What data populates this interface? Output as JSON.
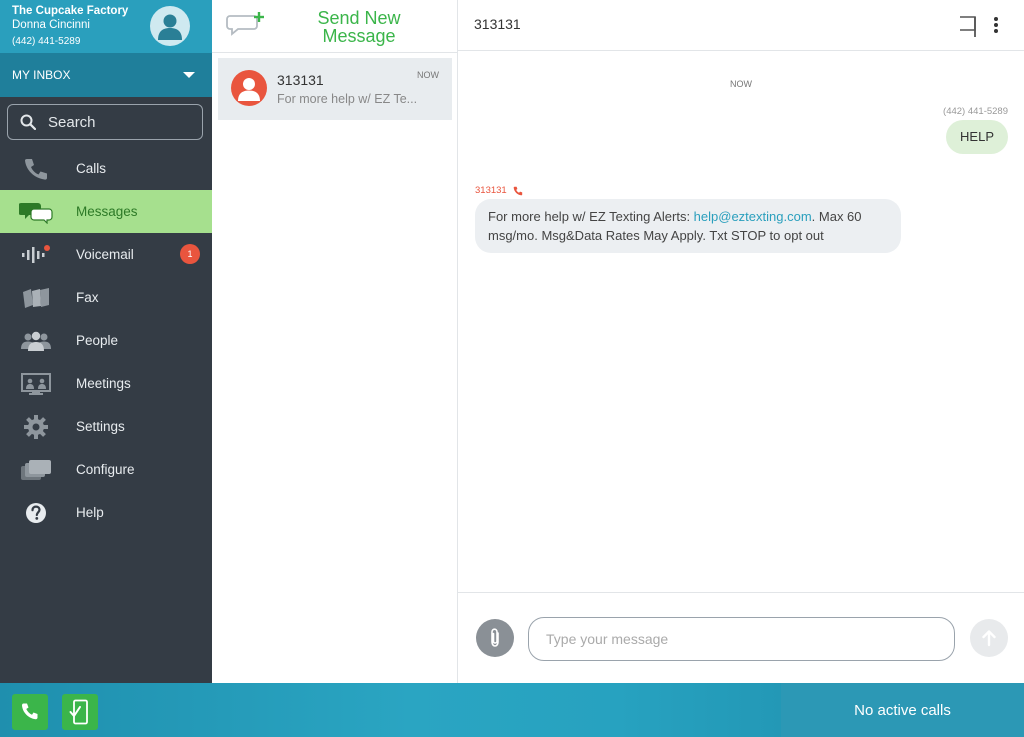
{
  "account": {
    "company": "The Cupcake Factory",
    "user": "Donna Cincinni",
    "phone": "(442) 441-5289"
  },
  "inbox": {
    "label": "MY INBOX"
  },
  "search": {
    "placeholder": "Search"
  },
  "nav": {
    "items": [
      {
        "label": "Calls",
        "icon": "phone-icon"
      },
      {
        "label": "Messages",
        "icon": "chat-bubbles-icon",
        "active": true
      },
      {
        "label": "Voicemail",
        "icon": "voicemail-icon",
        "badge": "1"
      },
      {
        "label": "Fax",
        "icon": "fax-icon"
      },
      {
        "label": "People",
        "icon": "people-icon"
      },
      {
        "label": "Meetings",
        "icon": "meetings-icon"
      },
      {
        "label": "Settings",
        "icon": "gear-icon"
      },
      {
        "label": "Configure",
        "icon": "configure-icon"
      },
      {
        "label": "Help",
        "icon": "help-icon"
      }
    ]
  },
  "conversations": {
    "new_message_label": "Send New Message",
    "items": [
      {
        "name": "313131",
        "time": "NOW",
        "preview": "For more help w/ EZ Te..."
      }
    ]
  },
  "chat": {
    "title": "313131",
    "time_separator": "NOW",
    "outgoing": {
      "sender": "(442) 441-5289",
      "text": "HELP"
    },
    "incoming": {
      "sender": "313131",
      "text_before": "For more help w/ EZ Texting Alerts: ",
      "link": "help@eztexting.com",
      "text_after": ". Max 60 msg/mo. Msg&Data Rates May Apply. Txt STOP to opt out"
    },
    "composer": {
      "placeholder": "Type your message",
      "value": ""
    }
  },
  "footer": {
    "status": "No active calls"
  },
  "colors": {
    "brand_teal": "#2a9fbd",
    "sidebar_bg": "#343c45",
    "active_green": "#a6e08e",
    "accent_green": "#3bb54a",
    "alert_red": "#e9553e"
  }
}
